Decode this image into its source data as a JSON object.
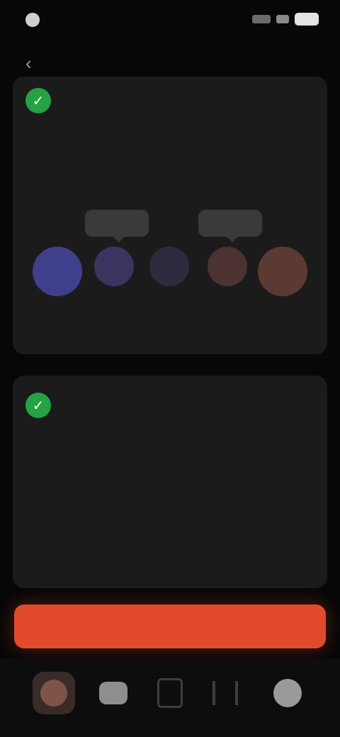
{
  "status": {
    "time": ""
  },
  "header": {
    "title": ""
  },
  "card1": {
    "title": "",
    "text": "",
    "bubbles": [
      "",
      ""
    ],
    "players": [
      {
        "name": "",
        "color": "#3f3f8c"
      },
      {
        "name": "",
        "color": "#3b3460"
      },
      {
        "name": "",
        "color": "#2f2a3f"
      },
      {
        "name": "",
        "color": "#4d3232"
      },
      {
        "name": "",
        "color": "#5a3a33"
      }
    ]
  },
  "card2": {
    "title": "",
    "text1": "",
    "text2": ""
  },
  "cta": {
    "label": ""
  },
  "colors": {
    "accent_red": "#e24a2c",
    "accent_green": "#25a244",
    "card_bg": "#1b1b1b"
  },
  "nav": {
    "items": [
      "avatar",
      "home-icon",
      "cards-icon",
      "stats-icon",
      "profile-icon"
    ]
  }
}
